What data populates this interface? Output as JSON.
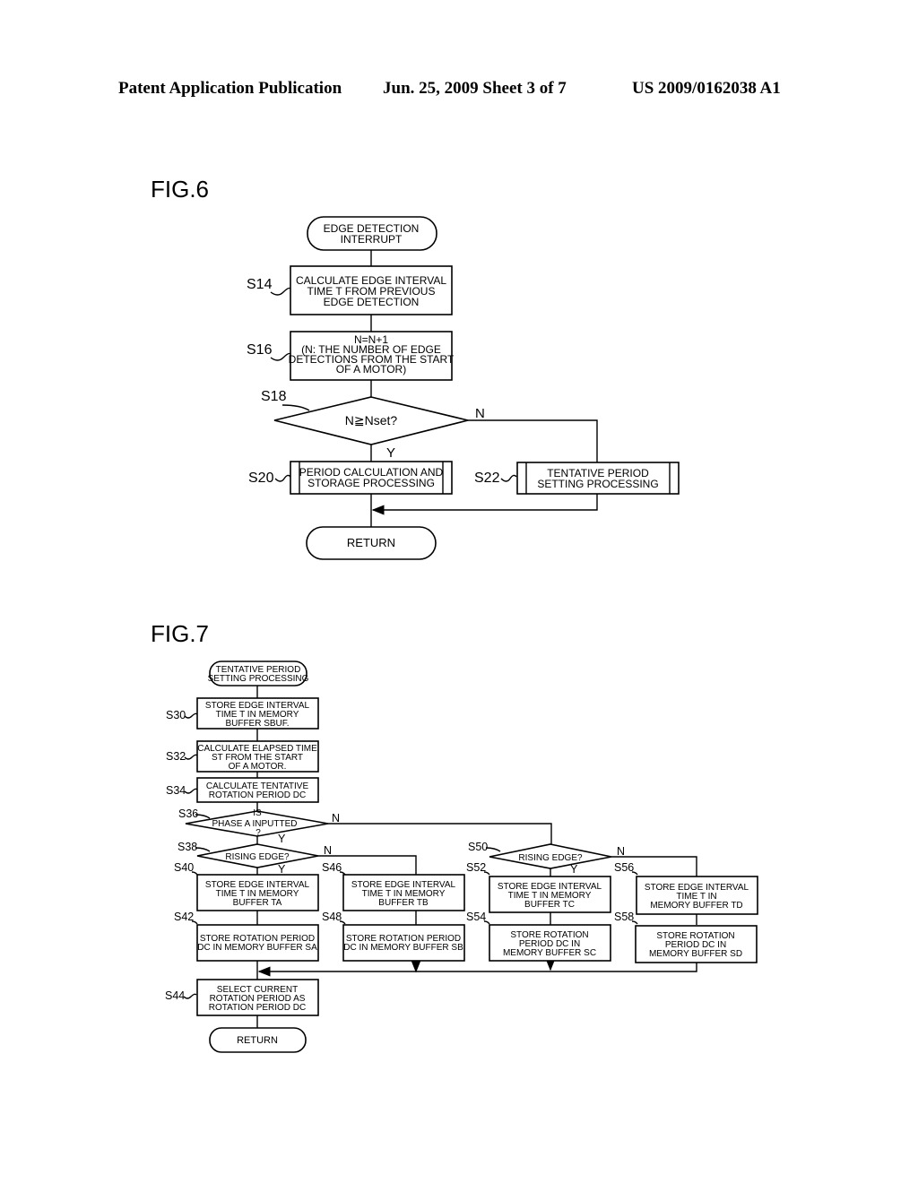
{
  "header": {
    "left": "Patent Application Publication",
    "middle": "Jun. 25, 2009  Sheet 3 of 7",
    "right": "US 2009/0162038 A1"
  },
  "fig6": {
    "title": "FIG.6",
    "start": [
      "EDGE DETECTION",
      "INTERRUPT"
    ],
    "s14": {
      "label": "S14",
      "text": [
        "CALCULATE EDGE INTERVAL",
        "TIME T FROM PREVIOUS",
        "EDGE DETECTION"
      ]
    },
    "s16": {
      "label": "S16",
      "text": [
        "N=N+1",
        "(N: THE NUMBER OF EDGE",
        "DETECTIONS FROM THE START",
        "OF A MOTOR)"
      ]
    },
    "s18": {
      "label": "S18",
      "text": "N≧Nset?",
      "yes": "Y",
      "no": "N"
    },
    "s20": {
      "label": "S20",
      "text": [
        "PERIOD CALCULATION AND",
        "STORAGE PROCESSING"
      ]
    },
    "s22": {
      "label": "S22",
      "text": [
        "TENTATIVE PERIOD",
        "SETTING PROCESSING"
      ]
    },
    "end": "RETURN"
  },
  "fig7": {
    "title": "FIG.7",
    "start": [
      "TENTATIVE PERIOD",
      "SETTING PROCESSING"
    ],
    "s30": {
      "label": "S30",
      "text": [
        "STORE EDGE INTERVAL",
        "TIME T IN MEMORY",
        "BUFFER SBUF."
      ]
    },
    "s32": {
      "label": "S32",
      "text": [
        "CALCULATE ELAPSED TIME",
        "ST FROM THE START",
        "OF A MOTOR."
      ]
    },
    "s34": {
      "label": "S34",
      "text": [
        "CALCULATE TENTATIVE",
        "ROTATION PERIOD DC"
      ]
    },
    "s36": {
      "label": "S36",
      "text": [
        "IS",
        "PHASE A INPUTTED",
        "?"
      ],
      "yes": "Y",
      "no": "N"
    },
    "s38": {
      "label": "S38",
      "text": "RISING EDGE?",
      "yes": "Y",
      "no": "N"
    },
    "s40": {
      "label": "S40",
      "text": [
        "STORE EDGE INTERVAL",
        "TIME T IN MEMORY",
        "BUFFER TA"
      ]
    },
    "s42": {
      "label": "S42",
      "text": [
        "STORE ROTATION PERIOD",
        "DC IN MEMORY BUFFER SA"
      ]
    },
    "s46": {
      "label": "S46",
      "text": [
        "STORE EDGE INTERVAL",
        "TIME T IN MEMORY",
        "BUFFER TB"
      ]
    },
    "s48": {
      "label": "S48",
      "text": [
        "STORE ROTATION PERIOD",
        "DC IN MEMORY BUFFER SB"
      ]
    },
    "s50": {
      "label": "S50",
      "text": "RISING EDGE?",
      "yes": "Y",
      "no": "N"
    },
    "s52": {
      "label": "S52",
      "text": [
        "STORE EDGE INTERVAL",
        "TIME T IN MEMORY",
        "BUFFER TC"
      ]
    },
    "s54": {
      "label": "S54",
      "text": [
        "STORE ROTATION",
        "PERIOD DC IN",
        "MEMORY BUFFER SC"
      ]
    },
    "s56": {
      "label": "S56",
      "text": [
        "STORE EDGE INTERVAL",
        "TIME T IN",
        "MEMORY BUFFER TD"
      ]
    },
    "s58": {
      "label": "S58",
      "text": [
        "STORE ROTATION",
        "PERIOD DC IN",
        "MEMORY BUFFER SD"
      ]
    },
    "s44": {
      "label": "S44",
      "text": [
        "SELECT CURRENT",
        "ROTATION PERIOD AS",
        "ROTATION PERIOD DC"
      ]
    },
    "end": "RETURN"
  }
}
